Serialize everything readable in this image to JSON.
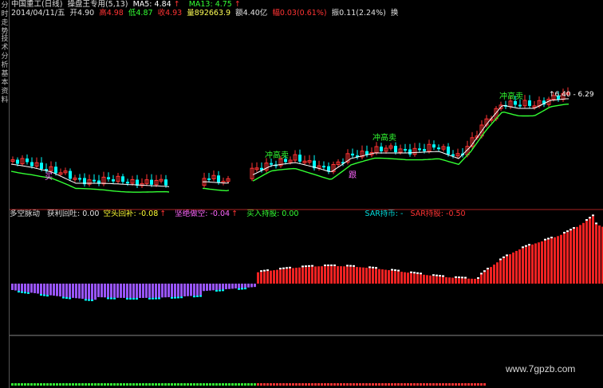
{
  "sidebar": {
    "tabs": [
      {
        "label": "分时走势",
        "state": "normal"
      },
      {
        "label": "技术分析",
        "state": "active"
      },
      {
        "label": "基本资料",
        "state": "normal"
      }
    ]
  },
  "header": {
    "title": "中国重工(日线)",
    "formula": "操盘王专用(5,13)",
    "ma5": "MA5: 4.84",
    "ma13": "MA13: 4.75",
    "date": "2014/04/11/五",
    "open": "开4.90",
    "high": "高4.98",
    "low": "低4.87",
    "close": "收4.93",
    "volume": "量892663.9",
    "amount": "额4.40亿",
    "change": "幅0.03(0.61%)",
    "amplitude": "振0.11(2.24%)",
    "extra": "换"
  },
  "annotations": {
    "chq1": "冲高卖",
    "chq2": "冲高卖",
    "chq3": "冲高卖",
    "buy": "买",
    "follow": "跟",
    "peak": "↑6.40 - 6.29"
  },
  "indicator_header": {
    "name": "多空脉动",
    "profit_back": "获利回吐: 0.00",
    "short_back": "空头回补: -0.08",
    "kill_short": "坚绝做空: -0.04",
    "buy_hold": "买入持股: 0.00",
    "sar_coin": "SAR持币: -",
    "sar_stock": "SAR持股: -0.50"
  },
  "watermark": "www.7gpzb.com",
  "colors": {
    "up": "#ff3333",
    "down": "#00ffff",
    "ma5": "#ffffff",
    "ma13": "#33ff33",
    "bar_bull": "#ee2222",
    "bar_bear": "#9955ff",
    "dots_sell": "#ff3333",
    "dots_buy": "#33ee33"
  }
}
